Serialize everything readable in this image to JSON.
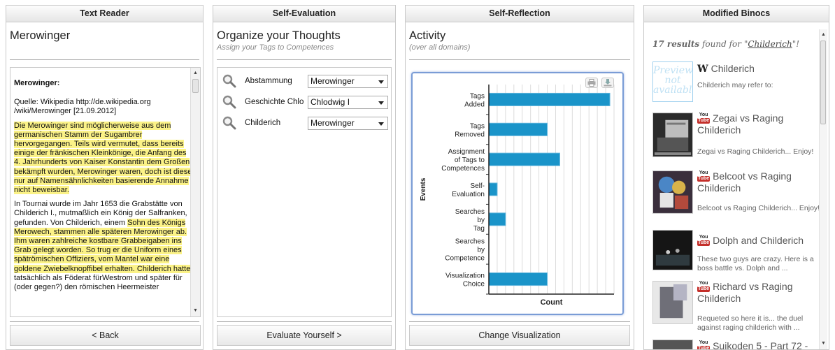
{
  "reader": {
    "header": "Text Reader",
    "title": "Merowinger",
    "heading": "Merowinger:",
    "source": "Quelle: Wikipedia http://de.wikipedia.org /wiki/Merowinger [21.09.2012]",
    "p1": "Die Merowinger sind möglicherweise aus dem germanischen Stamm der Sugambrer hervorgegangen. Teils wird vermutet, dass bereits einige der fränkischen Kleinkönige, die Anfang des 4. Jahrhunderts von Kaiser Konstantin dem Großen bekämpft wurden, Merowinger waren, doch ist diese nur auf Namensähnlichkeiten basierende Annahme nicht beweisbar.",
    "p2a": "In Tournai wurde im Jahr 1653 die Grabstätte von Childerich I., mutmaßlich ein König der Salfranken, gefunden. Von Childerich, einem ",
    "p2b": "Sohn des Königs Merowech, stammen alle späteren Merowinger ab. Ihm waren zahlreiche kostbare Grabbeigaben ins Grab gelegt worden. So trug er die Uniform eines spätrömischen Offiziers, vom Mantel war eine goldene Zwiebelknopffibel erhalten. Childerich hatte",
    "p2c": " tatsächlich als Föderat fürWestrom und später für (oder gegen?) den römischen Heermeister",
    "back_button": "< Back"
  },
  "evaluation": {
    "header": "Self-Evaluation",
    "title": "Organize your Thoughts",
    "subtitle": "Assign your Tags to Competences",
    "rows": [
      {
        "tag": "Abstammung",
        "competence": "Merowinger"
      },
      {
        "tag": "Geschichte Chlo",
        "competence": "Chlodwig I"
      },
      {
        "tag": "Childerich",
        "competence": "Merowinger"
      }
    ],
    "evaluate_button": "Evaluate Yourself >"
  },
  "reflection": {
    "header": "Self-Reflection",
    "title": "Activity",
    "subtitle": "(over all domains)",
    "change_button": "Change Visualization",
    "print_icon": "print-icon",
    "export_icon": "download-icon"
  },
  "chart_data": {
    "type": "bar",
    "orientation": "horizontal",
    "categories": [
      "Tags Added",
      "Tags Removed",
      "Assignment of Tags to Competences",
      "Self-Evaluation",
      "Searches by Tag",
      "Searches by Competence",
      "Visualization Choice"
    ],
    "category_lines": [
      [
        "Tags",
        "Added"
      ],
      [
        "Tags",
        "Removed"
      ],
      [
        "Assignment",
        "of Tags to",
        "Competences"
      ],
      [
        "Self-",
        "Evaluation"
      ],
      [
        "Searches",
        "by",
        "Tag"
      ],
      [
        "Searches",
        "by",
        "Competence"
      ],
      [
        "Visualization",
        "Choice"
      ]
    ],
    "values": [
      14.5,
      7,
      8.5,
      1,
      2,
      0,
      7
    ],
    "xlim": [
      0,
      15
    ],
    "xlabel": "Count",
    "ylabel": "Events",
    "grid": true,
    "bar_color": "#1a94c9"
  },
  "binocs": {
    "header": "Modified Binocs",
    "count": "17 results",
    "found_text": " found for \"",
    "query": "Childerich",
    "end": "\"!",
    "results": [
      {
        "title": "Childerich",
        "prefix": "W",
        "desc": "Childerich may refer to:",
        "thumb": "Preview not available",
        "kind": "wiki"
      },
      {
        "title": "Zegai vs Raging Childerich",
        "desc": "Zegai vs Raging Childerich... Enjoy!",
        "kind": "youtube"
      },
      {
        "title": "Belcoot vs Raging Childerich",
        "desc": "Belcoot vs Raging Childerich... Enjoy!",
        "kind": "youtube"
      },
      {
        "title": "Dolph and Childerich",
        "desc": "These two guys are crazy. Here is a boss battle vs. Dolph and ...",
        "kind": "youtube"
      },
      {
        "title": "Richard vs Raging Childerich",
        "desc": "Requeted so here it is... the duel against raging childerich with ...",
        "kind": "youtube"
      },
      {
        "title": "Suikoden 5 - Part 72 -",
        "desc": "",
        "kind": "youtube"
      }
    ],
    "youtube_logo_top": "You",
    "youtube_logo_bottom": "Tube"
  }
}
